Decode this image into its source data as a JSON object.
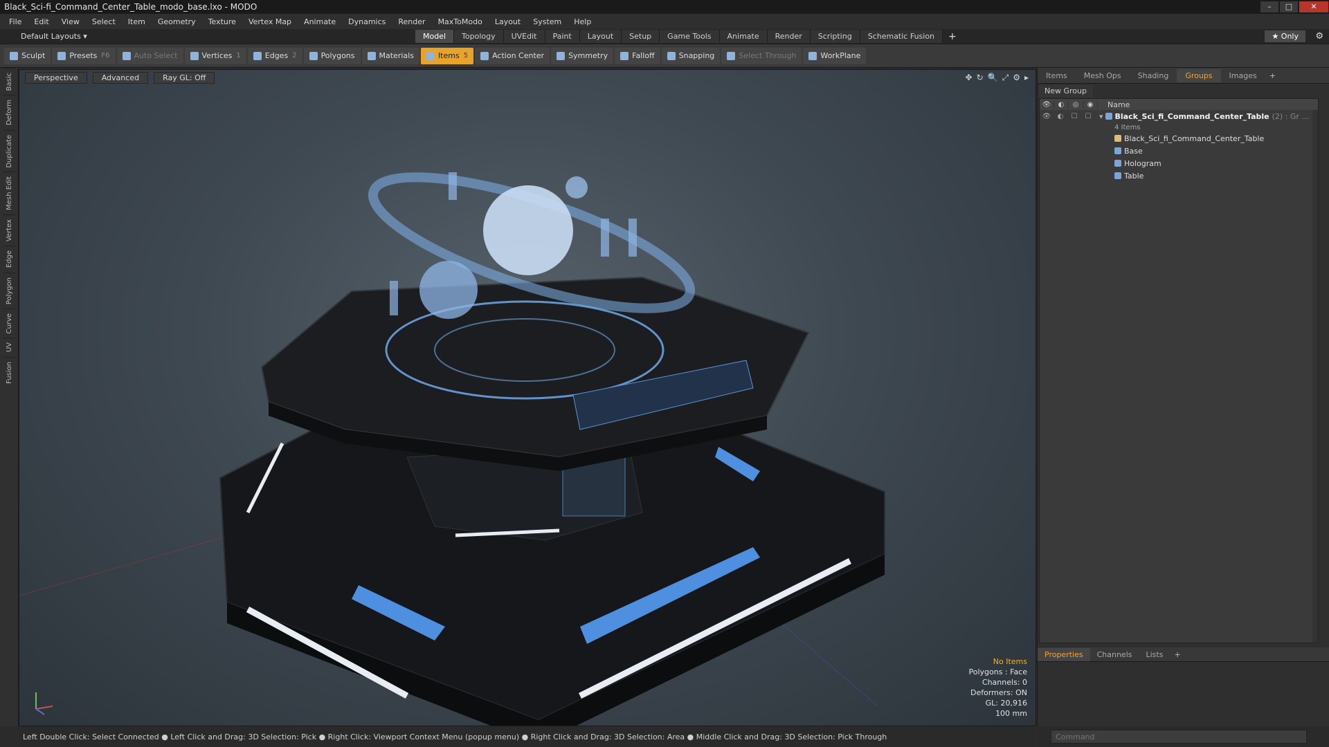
{
  "window": {
    "title": "Black_Sci-fi_Command_Center_Table_modo_base.lxo - MODO",
    "min": "–",
    "max": "□",
    "close": "✕"
  },
  "menu": [
    "File",
    "Edit",
    "View",
    "Select",
    "Item",
    "Geometry",
    "Texture",
    "Vertex Map",
    "Animate",
    "Dynamics",
    "Render",
    "MaxToModo",
    "Layout",
    "System",
    "Help"
  ],
  "layouts": {
    "current": "Default Layouts ▾",
    "tabs": [
      "Model",
      "Topology",
      "UVEdit",
      "Paint",
      "Layout",
      "Setup",
      "Game Tools",
      "Animate",
      "Render",
      "Scripting",
      "Schematic Fusion"
    ],
    "active": "Model",
    "plus": "+",
    "only": "★  Only",
    "gear": "⚙"
  },
  "toolbar": [
    {
      "label": "Sculpt",
      "key": ""
    },
    {
      "label": "Presets",
      "key": "F6"
    },
    {
      "label": "Auto Select",
      "key": "",
      "dim": true
    },
    {
      "label": "Vertices",
      "key": "1"
    },
    {
      "label": "Edges",
      "key": "2"
    },
    {
      "label": "Polygons",
      "key": ""
    },
    {
      "label": "Materials",
      "key": ""
    },
    {
      "label": "Items",
      "key": "5",
      "active": true
    },
    {
      "label": "Action Center",
      "key": ""
    },
    {
      "label": "Symmetry",
      "key": ""
    },
    {
      "label": "Falloff",
      "key": ""
    },
    {
      "label": "Snapping",
      "key": ""
    },
    {
      "label": "Select Through",
      "key": "",
      "dim": true
    },
    {
      "label": "WorkPlane",
      "key": ""
    }
  ],
  "left_tabs": [
    "Basic",
    "Deform",
    "Duplicate",
    "Mesh Edit",
    "Vertex",
    "Edge",
    "Polygon",
    "Curve",
    "UV",
    "Fusion"
  ],
  "viewport": {
    "buttons": [
      "Perspective",
      "Advanced",
      "Ray GL: Off"
    ],
    "icons": [
      "✥",
      "↻",
      "🔍",
      "⤢",
      "⚙",
      "▸"
    ],
    "hud": [
      "No Items",
      "Polygons : Face",
      "Channels: 0",
      "Deformers: ON",
      "GL: 20,916",
      "100 mm"
    ]
  },
  "right_panel": {
    "tabs": [
      "Items",
      "Mesh Ops",
      "Shading",
      "Groups",
      "Images"
    ],
    "active": "Groups",
    "plus": "+",
    "new_group": "New Group",
    "header_name": "Name",
    "group": {
      "name": "Black_Sci_fi_Command_Center_Table",
      "suffix": "(2) : Gr ...",
      "count": "4 Items"
    },
    "children": [
      "Black_Sci_fi_Command_Center_Table",
      "Base",
      "Hologram",
      "Table"
    ]
  },
  "props_panel": {
    "tabs": [
      "Properties",
      "Channels",
      "Lists"
    ],
    "active": "Properties",
    "plus": "+"
  },
  "status": "Left Double Click: Select Connected ● Left Click and Drag: 3D Selection: Pick ● Right Click: Viewport Context Menu (popup menu) ● Right Click and Drag: 3D Selection: Area ● Middle Click and Drag: 3D Selection: Pick Through",
  "command": {
    "placeholder": "Command"
  }
}
